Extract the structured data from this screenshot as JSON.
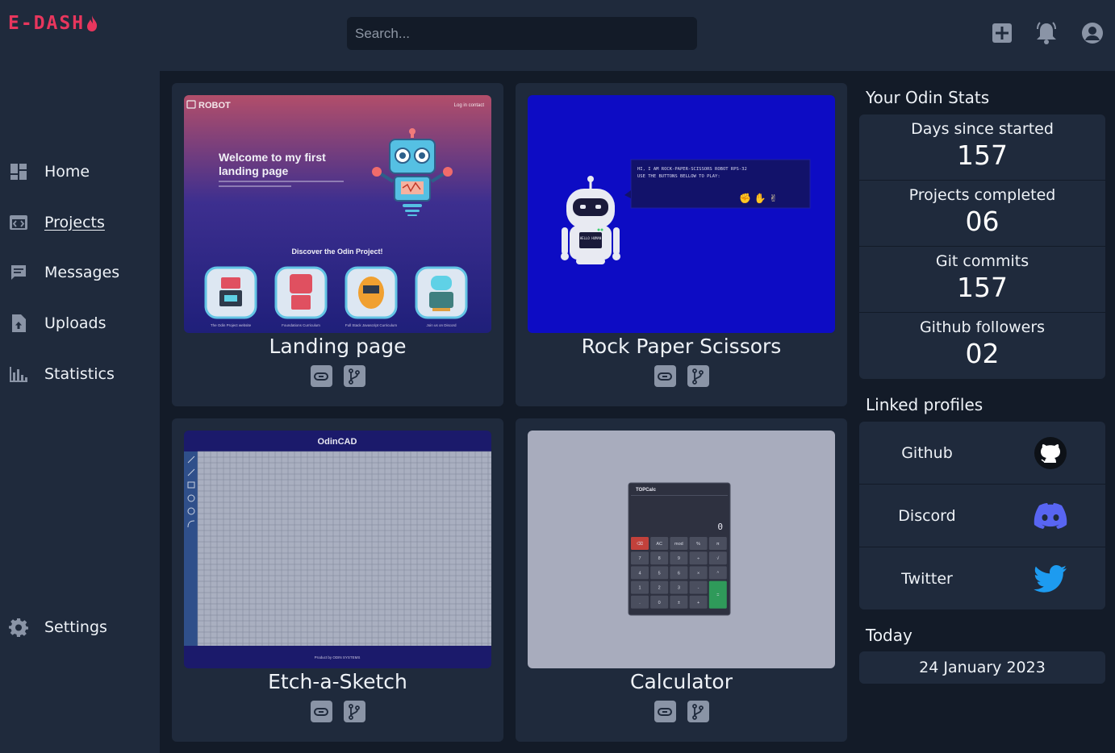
{
  "app": {
    "logo_text": "E-DASH"
  },
  "search": {
    "placeholder": "Search..."
  },
  "topbar": {
    "icons": [
      "add-icon",
      "bell-icon",
      "account-icon"
    ]
  },
  "sidebar": {
    "items": [
      {
        "label": "Home",
        "icon": "dashboard-icon"
      },
      {
        "label": "Projects",
        "icon": "projects-icon",
        "active": true
      },
      {
        "label": "Messages",
        "icon": "message-icon"
      },
      {
        "label": "Uploads",
        "icon": "upload-icon"
      },
      {
        "label": "Statistics",
        "icon": "chart-icon"
      },
      {
        "label": "Settings",
        "icon": "gear-icon"
      }
    ]
  },
  "projects": [
    {
      "title": "Landing page",
      "preview": {
        "brand": "ROBOT",
        "nav": "Log in   contact",
        "heading": "Welcome to my first landing page",
        "subtext": "The landing page is an assignment of the Odin project foundations course.",
        "discover": "Discover the Odin Project!",
        "captions": [
          "The Odin Project website",
          "Foundations Curriculum",
          "Full Stack Javascript Curriculum",
          "Join us on Discord"
        ]
      }
    },
    {
      "title": "Rock Paper Scissors",
      "preview": {
        "speech_line1": "HI, I AM ROCK-PAPER-SCISSORS ROBOT RPS-32",
        "speech_line2": "USE THE BUTTONS BELLOW TO PLAY:",
        "screen": "HELLO HUMAN"
      }
    },
    {
      "title": "Etch-a-Sketch",
      "preview": {
        "brand": "OdinCAD",
        "footer": "Product by ODIN SYSTEMS"
      }
    },
    {
      "title": "Calculator",
      "preview": {
        "brand": "TOPCalc",
        "display": "0",
        "keys": [
          "⌫",
          "AC",
          "mod",
          "%",
          "π",
          "7",
          "8",
          "9",
          "÷",
          "√",
          "4",
          "5",
          "6",
          "×",
          "^",
          "1",
          "2",
          "3",
          "-",
          "=",
          ".",
          "0",
          "±",
          "+"
        ]
      }
    }
  ],
  "stats": {
    "heading": "Your Odin Stats",
    "items": [
      {
        "label": "Days since started",
        "value": "157"
      },
      {
        "label": "Projects completed",
        "value": "06"
      },
      {
        "label": "Git commits",
        "value": "157"
      },
      {
        "label": "Github followers",
        "value": "02"
      }
    ]
  },
  "profiles": {
    "heading": "Linked profiles",
    "items": [
      {
        "label": "Github",
        "icon": "github-icon"
      },
      {
        "label": "Discord",
        "icon": "discord-icon",
        "color": "#5865f2"
      },
      {
        "label": "Twitter",
        "icon": "twitter-icon",
        "color": "#1d9bf0"
      }
    ]
  },
  "today": {
    "heading": "Today",
    "date": "24 January 2023"
  },
  "colors": {
    "accent": "#e8365d",
    "background": "#131b28",
    "panel": "#1f2a3c"
  }
}
